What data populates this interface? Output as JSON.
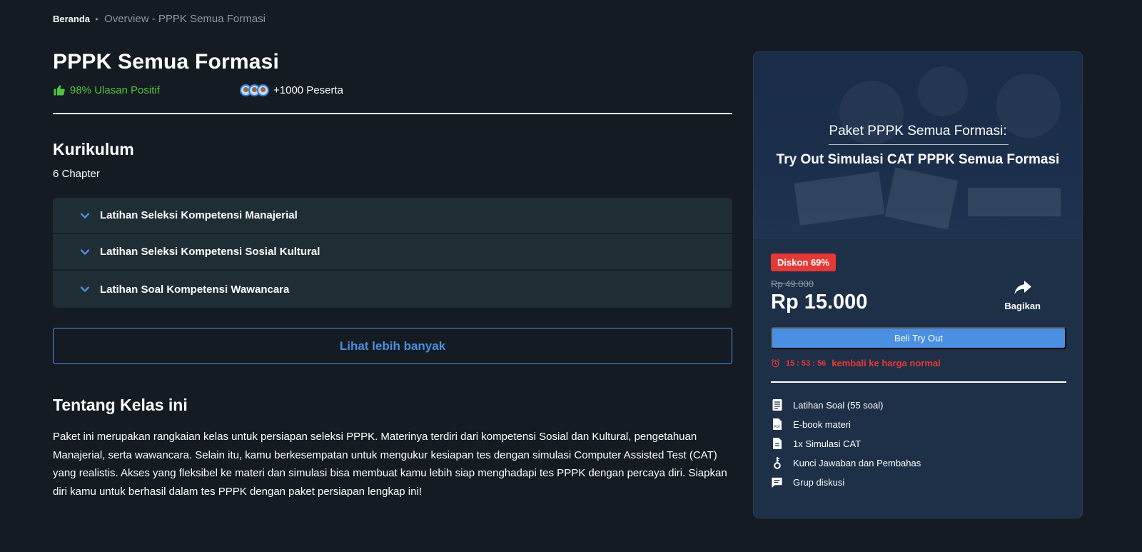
{
  "breadcrumb": {
    "home": "Beranda",
    "current": "Overview - PPPK Semua Formasi"
  },
  "header": {
    "title": "PPPK Semua Formasi",
    "rating": "98% Ulasan Positif",
    "participants": "+1000 Peserta"
  },
  "curriculum": {
    "title": "Kurikulum",
    "count": "6 Chapter",
    "items": [
      {
        "label": "Latihan Seleksi Kompetensi Manajerial"
      },
      {
        "label": "Latihan Seleksi Kompetensi Sosial Kultural"
      },
      {
        "label": "Latihan Soal Kompetensi Wawancara"
      }
    ],
    "more_label": "Lihat lebih banyak"
  },
  "about": {
    "title": "Tentang Kelas ini",
    "text": "Paket ini merupakan rangkaian kelas untuk persiapan seleksi PPPK. Materinya terdiri dari kompetensi Sosial dan Kultural, pengetahuan Manajerial, serta wawancara. Selain itu, kamu berkesempatan untuk mengukur kesiapan tes dengan simulasi Computer Assisted Test (CAT) yang realistis. Akses yang fleksibel ke materi dan simulasi bisa membuat kamu lebih siap menghadapi tes PPPK dengan percaya diri. Siapkan diri kamu untuk berhasil dalam tes PPPK dengan paket persiapan lengkap ini!"
  },
  "card": {
    "banner_sub": "Paket PPPK Semua Formasi:",
    "banner_main": "Try Out Simulasi CAT PPPK Semua Formasi",
    "discount": "Diskon 69%",
    "old_price": "Rp 49.000",
    "price": "Rp 15.000",
    "share_label": "Bagikan",
    "buy_label": "Beli Try Out",
    "timer": "15 : 53 : 56",
    "timer_text": "kembali ke harga normal",
    "features": [
      {
        "icon": "document-icon",
        "label": "Latihan Soal (55 soal)"
      },
      {
        "icon": "pdf-icon",
        "label": "E-book materi"
      },
      {
        "icon": "file-icon",
        "label": "1x Simulasi CAT"
      },
      {
        "icon": "key-icon",
        "label": "Kunci Jawaban dan Pembahas"
      },
      {
        "icon": "chat-icon",
        "label": "Grup diskusi"
      }
    ]
  },
  "colors": {
    "background": "#141b22",
    "accent": "#4a8fe2",
    "positive": "#53c33b",
    "danger": "#e53935",
    "card": "#1e3047"
  }
}
